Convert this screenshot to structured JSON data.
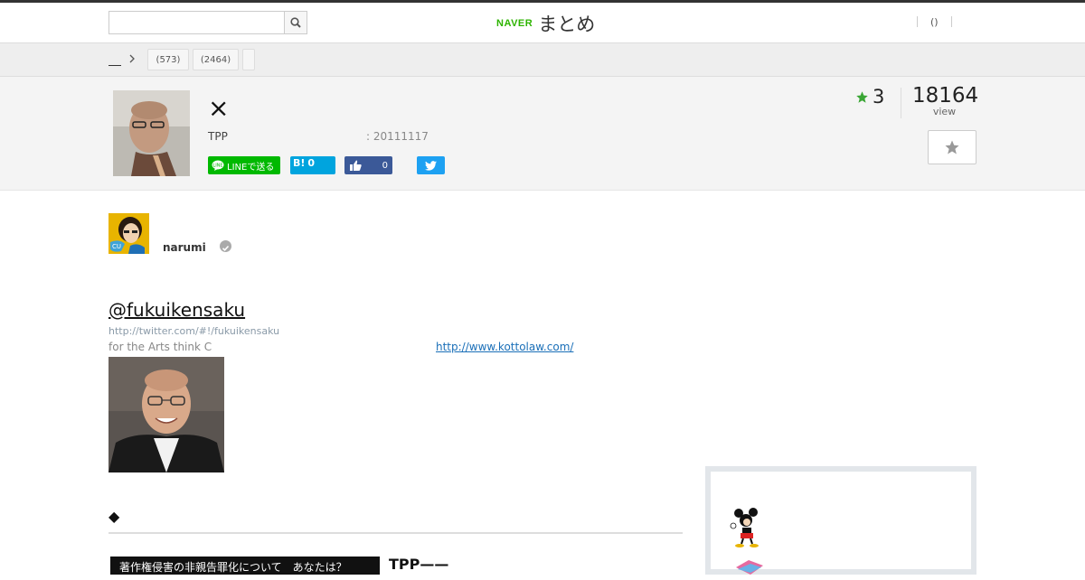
{
  "header": {
    "search": {
      "value": "",
      "placeholder": ""
    },
    "logo": {
      "brand": "NAVER",
      "name": "まとめ"
    },
    "right": {
      "paren": "()"
    }
  },
  "category_bar": {
    "home": "",
    "tags": [
      {
        "label": "(573)"
      },
      {
        "label": "(2464)"
      },
      {
        "label": ""
      }
    ]
  },
  "article": {
    "title": "×",
    "description": "TPP",
    "updated": ": 20111117",
    "share": {
      "line_label": "LINEで送る",
      "hatena_label": "B!",
      "hatena_count": "0",
      "fb_count": "0"
    },
    "favorites": "3",
    "views": "18164",
    "views_label": "view"
  },
  "author": {
    "name": "narumi"
  },
  "content": {
    "handle": "@fukuikensaku",
    "handle_url": "http://twitter.com/#!/fukuikensaku",
    "arts_text": " for the Arts think C",
    "external_link": "http://www.kottolaw.com/",
    "section_heading": "◆",
    "banner_text": "著作権侵害の非親告罪化について　あなたは？",
    "tpp_title": "TPP——"
  },
  "colors": {
    "naver_green": "#2db400",
    "line_green": "#00b900",
    "hatena_blue": "#00a4de",
    "facebook_blue": "#3b5998",
    "twitter_blue": "#1da1f2",
    "star_green": "#3aa635"
  }
}
